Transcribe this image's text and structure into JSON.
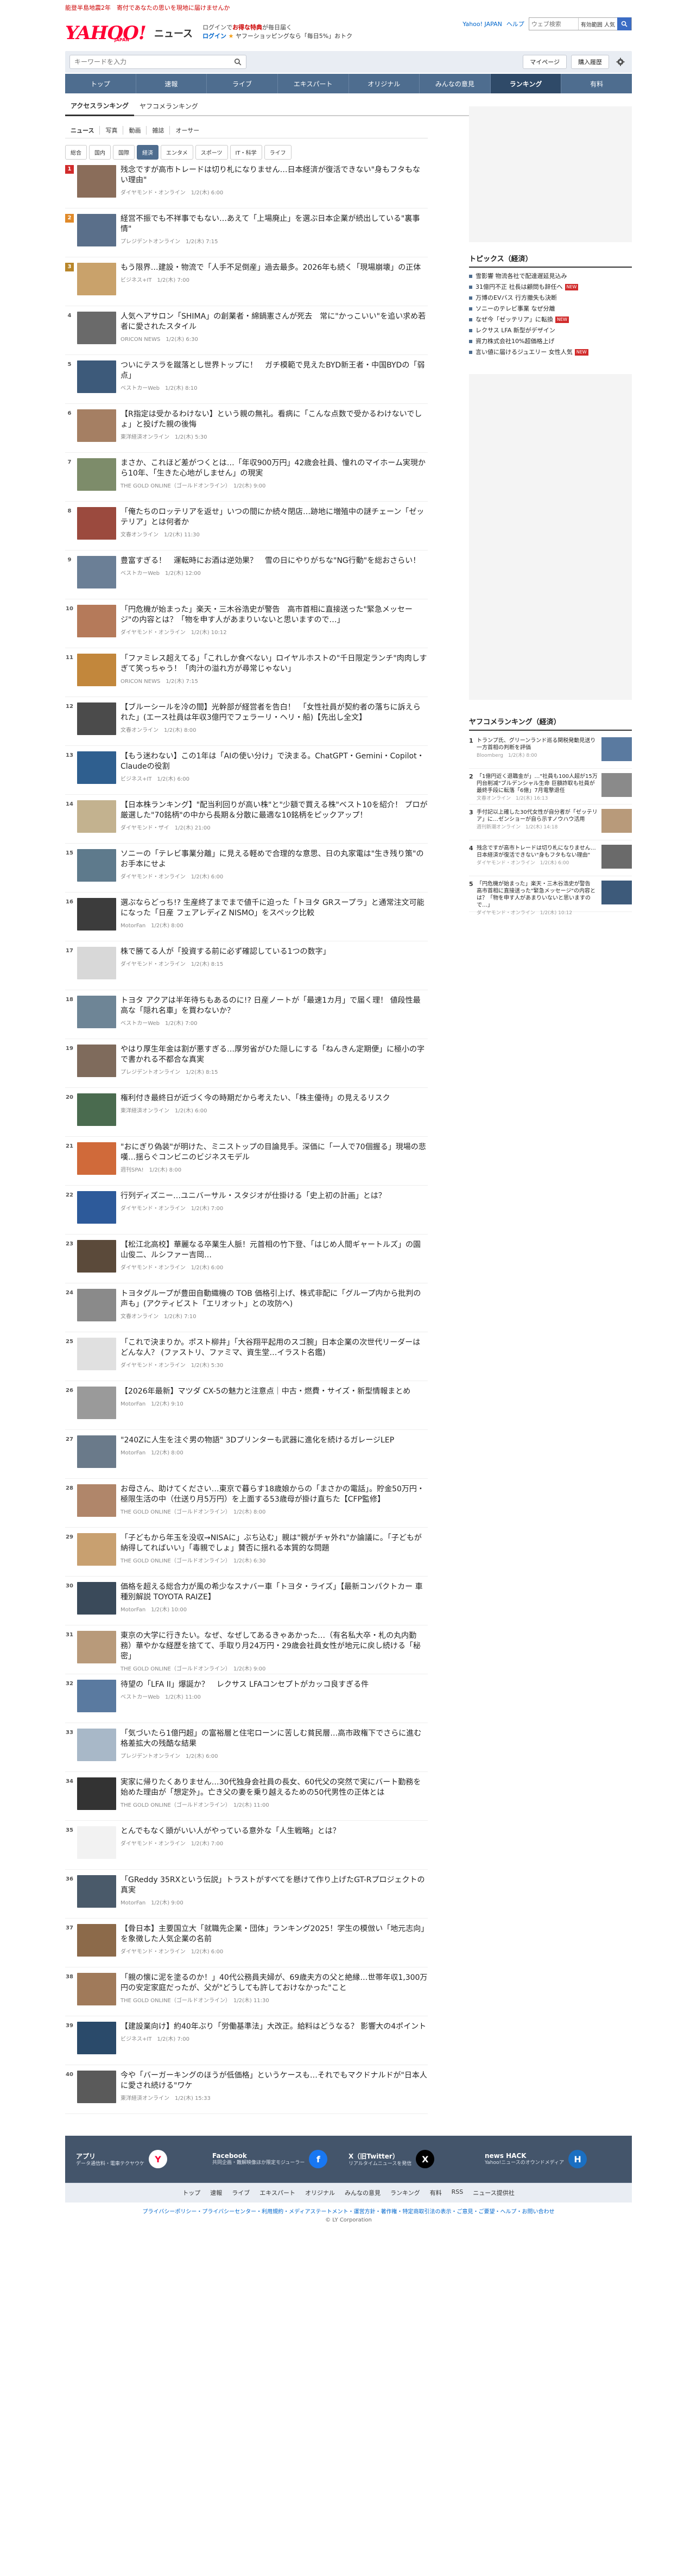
{
  "topstrip": "能登半島地震2年　寄付であなたの思いを現地に届けませんか",
  "header": {
    "logo_text": "YAHOO!",
    "logo_sub": "JAPAN",
    "section": "ニュース",
    "promo_line1_pre": "ログインで",
    "promo_line1_bold": "お得な特典",
    "promo_line1_post": "が毎日届く",
    "promo_login": "ログイン",
    "promo_line2": "ヤフーショッピングなら「毎日5%」おトク",
    "links": [
      "Yahoo! JAPAN",
      "ヘルプ"
    ],
    "search_placeholder": "ウェブ検索",
    "search_select": "有効範囲 人気"
  },
  "searchrow": {
    "placeholder": "キーワードを入力",
    "mypage": "マイページ",
    "subscribe": "購入履歴"
  },
  "nav": [
    "トップ",
    "速報",
    "ライブ",
    "エキスパート",
    "オリジナル",
    "みんなの意見",
    "ランキング",
    "有料"
  ],
  "nav_active": 6,
  "rank_tabs": [
    "アクセスランキング",
    "ヤフコメランキング"
  ],
  "sub_tabs": [
    "ニュース",
    "写真",
    "動画",
    "雑誌",
    "オーサー"
  ],
  "cat_tabs": [
    "総合",
    "国内",
    "国際",
    "経済",
    "エンタメ",
    "スポーツ",
    "IT・科学",
    "ライフ"
  ],
  "cat_active": 3,
  "ranking": [
    {
      "n": "1",
      "title": "残念ですが高市トレードは切り札になりません…日本経済が復活できない\"身もフタもない理由\"",
      "meta": "ダイヤモンド・オンライン　1/2(木) 6:00"
    },
    {
      "n": "2",
      "title": "経営不振でも不祥事でもない…あえて「上場廃止」を選ぶ日本企業が続出している\"裏事情\"",
      "meta": "プレジデントオンライン　1/2(木) 7:15"
    },
    {
      "n": "3",
      "title": "もう限界…建設・物流で「人手不足倒産」過去最多。2026年も続く「現場崩壊」の正体",
      "meta": "ビジネス+IT　1/2(木) 7:00"
    },
    {
      "n": "4",
      "title": "人気ヘアサロン「SHIMA」の創業者・綿鍋憲さんが死去　常に\"かっこいい\"を追い求め若者に愛されたスタイル",
      "meta": "ORICON NEWS　1/2(木) 6:30"
    },
    {
      "n": "5",
      "title": "ついにテスラを蹴落とし世界トップに！　ガチ模範で見えたBYD新王者・中国BYDの「弱点」",
      "meta": "ベストカーWeb　1/2(木) 8:10"
    },
    {
      "n": "6",
      "title": "【R指定は受かるわけない】という親の無礼。看病に「こんな点数で受かるわけないでしょ」と投げた親の後悔",
      "meta": "東洋経済オンライン　1/2(木) 5:30"
    },
    {
      "n": "7",
      "title": "まさか、これほど差がつくとは…「年収900万円」42歳会社員、憧れのマイホーム実現から10年、「生きた心地がしません」の現実",
      "meta": "THE GOLD ONLINE（ゴールドオンライン）　1/2(木) 9:00"
    },
    {
      "n": "8",
      "title": "「俺たちのロッテリアを返せ」いつの間にか続々閉店…跡地に増殖中の謎チェーン「ゼッテリア」とは何者か",
      "meta": "文春オンライン　1/2(木) 11:30"
    },
    {
      "n": "9",
      "title": "豊富すぎる！　運転時にお酒は逆効果？　雪の日にやりがちな\"NG行動\"を総おさらい！",
      "meta": "ベストカーWeb　1/2(木) 12:00"
    },
    {
      "n": "10",
      "title": "「円危機が始まった」楽天・三木谷浩史が警告　高市首相に直接送った\"緊急メッセージ\"の内容とは？「物を申す人があまりいないと思いますので…」",
      "meta": "ダイヤモンド・オンライン　1/2(木) 10:12"
    },
    {
      "n": "11",
      "title": "「ファミレス超えてる」「これしか食べない」ロイヤルホストの\"千日限定ランチ\"肉肉しすぎて笑っちゃう！「肉汁の溢れ方が尋常じゃない」",
      "meta": "ORICON NEWS　1/2(木) 7:15"
    },
    {
      "n": "12",
      "title": "【ブルーシールを冷の間】光幹部が経営者を告白！　「女性社員が契約者の落ちに訴えられた」(エース社員は年収3億円でフェラーリ・ヘリ・船)【先出し全文】",
      "meta": "文春オンライン　1/2(木) 8:00"
    },
    {
      "n": "13",
      "title": "【もう迷わない】この1年は「AIの使い分け」で決まる。ChatGPT・Gemini・Copilot・Claudeの役割",
      "meta": "ビジネス+IT　1/2(木) 6:00"
    },
    {
      "n": "14",
      "title": "【日本株ランキング】\"配当利回りが高い株\"と\"少額で買える株\"ベスト10を紹介！ プロが厳選した\"70銘柄\"の中から長期＆分散に最適な10銘柄をピックアップ！",
      "meta": "ダイヤモンド・ザイ　1/2(木) 21:00"
    },
    {
      "n": "15",
      "title": "ソニーの「テレビ事業分離」に見える軽めで合理的な意思、日の丸家電は\"生き残り策\"のお手本にせよ",
      "meta": "ダイヤモンド・オンライン　1/2(木) 6:00"
    },
    {
      "n": "16",
      "title": "選ぶならどっち!? 生産終了までまで値千に迫った「トヨタ GRスープラ」と通常注文可能になった「日産 フェアレディZ NISMO」をスペック比較",
      "meta": "MotorFan　1/2(木) 8:00"
    },
    {
      "n": "17",
      "title": "株で勝てる人が「投資する前に必ず確認している1つの数字」",
      "meta": "ダイヤモンド・オンライン　1/2(木) 8:15"
    },
    {
      "n": "18",
      "title": "トヨタ アクアは半年待ちもあるのに!? 日産ノートが「最速1カ月」で届く理！ 値段性最高な「隠れ名車」を買わないか？",
      "meta": "ベストカーWeb　1/2(木) 7:00"
    },
    {
      "n": "19",
      "title": "やはり厚生年金は割が悪すぎる…厚労省がひた隠しにする「ねんきん定期便」に極小の字で書かれる不都合な真実",
      "meta": "プレジデントオンライン　1/2(木) 8:15"
    },
    {
      "n": "20",
      "title": "権利付き最終日が近づく今の時期だから考えたい、「株主優待」の見えるリスク",
      "meta": "東洋経済オンライン　1/2(木) 6:00"
    },
    {
      "n": "21",
      "title": "\"おにぎり偽装\"が明けた、ミニストップの目論見手。深価に「一人で70個握る」現場の悲嘆…揺らぐコンビニのビジネスモデル",
      "meta": "週刊SPA!　1/2(木) 8:00"
    },
    {
      "n": "22",
      "title": "行列ディズニー…ユニバーサル・スタジオが仕掛ける「史上初の計画」とは？",
      "meta": "ダイヤモンド・オンライン　1/2(木) 7:00"
    },
    {
      "n": "23",
      "title": "【松江北高校】華麗なる卒業生人脈！元首相の竹下登、「はじめ人間ギャートルズ」の園山俊二、ルシファー吉岡…",
      "meta": "ダイヤモンド・オンライン　1/2(木) 6:00"
    },
    {
      "n": "24",
      "title": "トヨタグループが豊田自動織機の TOB 価格引上げ、株式非配に「グループ内から批判の声も」(アクティビスト「エリオット」との攻防へ)",
      "meta": "文春オンライン　1/2(木) 7:10"
    },
    {
      "n": "25",
      "title": "「これで決まりか。ポスト柳井」「大谷翔平起用のスゴ腕」日本企業の次世代リーダーはどんな人？ (ファストリ、ファミマ、資生堂…イラスト名鑑)",
      "meta": "ダイヤモンド・オンライン　1/2(木) 5:30"
    },
    {
      "n": "26",
      "title": "【2026年最新】マツダ CX-5の魅力と注意点｜中古・燃費・サイズ・新型情報まとめ",
      "meta": "MotorFan　1/2(木) 9:10"
    },
    {
      "n": "27",
      "title": "\"240Zに人生を注ぐ男の物語\" 3Dプリンターも武器に進化を続けるガレージLEP",
      "meta": "MotorFan　1/2(木) 8:00"
    },
    {
      "n": "28",
      "title": "お母さん、助けてください…東京で暮らす18歳娘からの「まさかの電話」。貯金50万円・極限生活の中（仕送り月5万円）を上面する53歳母が掛け直ちた【CFP監修】",
      "meta": "THE GOLD ONLINE（ゴールドオンライン）　1/2(木) 8:00"
    },
    {
      "n": "29",
      "title": "「子どもから年玉を没収→NISAに」ぶち込む」親は\"親がチャ外れ\"か論議に。「子どもが納得してればいい」「毒親でしょ」賛否に揺れる本質的な問題",
      "meta": "THE GOLD ONLINE（ゴールドオンライン）　1/2(木) 6:30"
    },
    {
      "n": "30",
      "title": "価格を超える総合力が風の希少なスナバー車「トヨタ・ライズ」【最新コンパクトカー 車種別解説 TOYOTA RAIZE】",
      "meta": "MotorFan　1/2(木) 10:00"
    },
    {
      "n": "31",
      "title": "東京の大学に行きたい。なぜ、なぜしてあるきゃあかった…（有名私大卒・札の丸内勤務）華やかな経歴を捨てて、手取り月24万円・29歳会社員女性が地元に戻し続ける「秘密」",
      "meta": "THE GOLD ONLINE（ゴールドオンライン）　1/2(木) 9:00"
    },
    {
      "n": "32",
      "title": "待望の「LFA II」爆誕か？　レクサス LFAコンセプトがカッコ良すぎる件",
      "meta": "ベストカーWeb　1/2(木) 11:00"
    },
    {
      "n": "33",
      "title": "「気づいたら1億円超」の富裕層と住宅ローンに苦しむ貧民層…高市政権下でさらに進む格差拡大の残酷な結果",
      "meta": "プレジデントオンライン　1/2(木) 6:00"
    },
    {
      "n": "34",
      "title": "実家に帰りたくありません…30代独身会社員の長女、60代父の突然で実にバート勤務を始めた理由が「想定外」。亡き父の妻を乗り越えるための50代男性の正体とは",
      "meta": "THE GOLD ONLINE（ゴールドオンライン）　1/2(木) 11:00"
    },
    {
      "n": "35",
      "title": "とんでもなく頭がいい人がやっている意外な「人生戦略」とは？",
      "meta": "ダイヤモンド・オンライン　1/2(木) 7:00"
    },
    {
      "n": "36",
      "title": "「GReddy 35RXという伝説」トラストがすべてを懸けて作り上げたGT-Rプロジェクトの真実",
      "meta": "MotorFan　1/2(木) 9:00"
    },
    {
      "n": "37",
      "title": "【骨日本】主要国立大「就職先企業・団体」ランキング2025！学生の模倣い「地元志向」を象徴した人気企業の名前",
      "meta": "ダイヤモンド・オンライン　1/2(木) 6:00"
    },
    {
      "n": "38",
      "title": "「親の懐に泥を塗るのか！」40代公務員夫婦が、69歳夫方の父と絶縁…世帯年収1,300万円の安定家庭だったが、父が\"どうしても許しておけなかった\"こと",
      "meta": "THE GOLD ONLINE（ゴールドオンライン）　1/2(木) 11:30"
    },
    {
      "n": "39",
      "title": "【建設業向け】約40年ぶり「労働基準法」大改正。給料はどうなる？ 影響大の4ポイント",
      "meta": "ビジネス+IT　1/2(木) 7:00"
    },
    {
      "n": "40",
      "title": "今や「バーガーキングのほうが低価格」というケースも…それでもマクドナルドが\"日本人に愛され続ける\"ワケ",
      "meta": "東洋経済オンライン　1/2(木) 15:33"
    }
  ],
  "sidebar": {
    "topics_title": "トピックス（経済）",
    "topics": [
      {
        "t": "雪影響 物流各社で配達遅延見込み",
        "new": false
      },
      {
        "t": "31億円不正 社長は顧問も辞任へ",
        "new": true
      },
      {
        "t": "万博のEVバス 行方撤失も決断",
        "new": false
      },
      {
        "t": "ソニーのテレビ事業 なぜ分離",
        "new": false
      },
      {
        "t": "なぜ今「ゼッテリア」に転換",
        "new": true
      },
      {
        "t": "レクサス LFA 新型がデザイン",
        "new": false
      },
      {
        "t": "資力株式会社10%超価格上げ",
        "new": false
      },
      {
        "t": "言い値に届けるジュエリー 女性人気",
        "new": true
      }
    ],
    "new_label": "NEW",
    "yahoo_rank_title": "ヤフコメランキング（経済）",
    "yahoo_rank": [
      {
        "n": "1",
        "t": "トランプ氏、グリーンランド巡る関税発動見送り 一方首相の判断を評価",
        "m": "Bloomberg　1/2(木) 8:00"
      },
      {
        "n": "2",
        "t": "「1億円近く退職金が」…\"社員も100人超が15万円台削减\"ブルデンシャル生命 巨額詐取も社員が最終手段に転落「6億」7月電撃退任",
        "m": "文春オンライン　1/2(木) 16:13"
      },
      {
        "n": "3",
        "t": "手付記以上確した30代女性が自分者が「ゼッテリア」に…ゼンショーが自ら示すノウハウ活用",
        "m": "週刊新潮オンライン　1/2(木) 14:18"
      },
      {
        "n": "4",
        "t": "残念ですが高市トレードは切り札になりません…日本経済が復活できない\"身もフタもない理由\"",
        "m": "ダイヤモンド・オンライン　1/2(木) 6:00"
      },
      {
        "n": "5",
        "t": "「円危機が始まった」楽天・三木谷浩史が警告　高市首相に直接送った\"緊急メッセージ\"の内容とは？「物を申す人があまりいないと思いますので…」",
        "m": "ダイヤモンド・オンライン　1/2(木) 10:12"
      }
    ]
  },
  "footer": {
    "cols": [
      {
        "t": "アプリ",
        "s": "データ通信料・電車テクヤウケ"
      },
      {
        "t": "Facebook",
        "s": "共同企画・難解映像ほか限定モジューラー"
      },
      {
        "t": "X（旧Twitter）",
        "s": "リアルタイムニュースを発信"
      },
      {
        "t": "news HACK",
        "s": "Yahoo!ニュースのオウンドメディア"
      }
    ],
    "nav": [
      "トップ",
      "速報",
      "ライブ",
      "エキスパート",
      "オリジナル",
      "みんなの意見",
      "ランキング",
      "有料",
      "RSS",
      "ニュース提供社"
    ],
    "legal": "プライバシーポリシー・プライバシーセンター・利用規約・メディアステートメント・運営方針・著作権・特定商取引法の表示・ご意見・ご要望・ヘルプ・お問い合わせ",
    "copyright": "© LY Corporation"
  }
}
